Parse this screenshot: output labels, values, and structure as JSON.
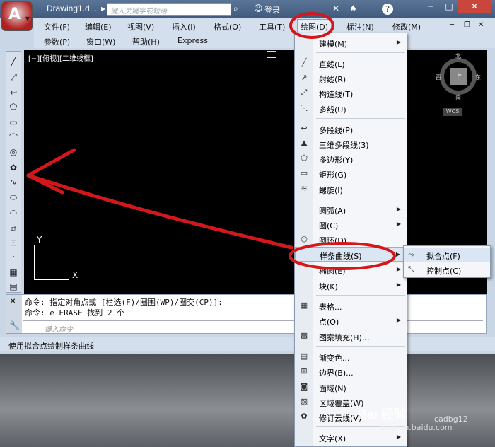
{
  "titlebar": {
    "doc_title": "Drawing1.d...",
    "search_placeholder": "键入关键字或短语",
    "login_label": "登录",
    "help_label": "?"
  },
  "menus": {
    "row1": [
      "文件(F)",
      "编辑(E)",
      "视图(V)",
      "插入(I)",
      "格式(O)",
      "工具(T)",
      "绘图(D)",
      "标注(N)",
      "修改(M)"
    ],
    "row2": [
      "参数(P)",
      "窗口(W)",
      "帮助(H)",
      "Express"
    ]
  },
  "canvas": {
    "view_label": "[−][俯视][二维线框]",
    "ucs_y": "Y",
    "ucs_x": "X"
  },
  "viewcube": {
    "north": "北",
    "south": "南",
    "east": "东",
    "west": "西",
    "top": "上",
    "wcs": "WCS"
  },
  "command": {
    "line1": "命令: 指定对角点或 [栏选(F)/圈围(WP)/圈交(CP)]:",
    "line2": "命令: e ERASE 找到 2 个",
    "input_placeholder": "键入命令"
  },
  "status": {
    "text": "使用拟合点绘制样条曲线"
  },
  "draw_menu": {
    "items": [
      {
        "label": "建模(M)",
        "icon": "",
        "submenu": true
      },
      {
        "label": "直线(L)",
        "icon": "line-icon",
        "submenu": false
      },
      {
        "label": "射线(R)",
        "icon": "ray-icon",
        "submenu": false
      },
      {
        "label": "构造线(T)",
        "icon": "xline-icon",
        "submenu": false
      },
      {
        "label": "多线(U)",
        "icon": "mline-icon",
        "submenu": false
      },
      {
        "label": "多段线(P)",
        "icon": "pline-icon",
        "submenu": false
      },
      {
        "label": "三维多段线(3)",
        "icon": "3dpoly-icon",
        "submenu": false
      },
      {
        "label": "多边形(Y)",
        "icon": "polygon-icon",
        "submenu": false
      },
      {
        "label": "矩形(G)",
        "icon": "rectangle-icon",
        "submenu": false
      },
      {
        "label": "螺旋(I)",
        "icon": "helix-icon",
        "submenu": false
      },
      {
        "label": "圆弧(A)",
        "icon": "",
        "submenu": true
      },
      {
        "label": "圆(C)",
        "icon": "",
        "submenu": true
      },
      {
        "label": "圆环(D)",
        "icon": "donut-icon",
        "submenu": false
      },
      {
        "label": "样条曲线(S)",
        "icon": "",
        "submenu": true
      },
      {
        "label": "椭圆(E)",
        "icon": "",
        "submenu": true
      },
      {
        "label": "块(K)",
        "icon": "",
        "submenu": true
      },
      {
        "label": "表格...",
        "icon": "table-icon",
        "submenu": false
      },
      {
        "label": "点(O)",
        "icon": "",
        "submenu": true
      },
      {
        "label": "图案填充(H)...",
        "icon": "hatch-icon",
        "submenu": false
      },
      {
        "label": "渐变色...",
        "icon": "gradient-icon",
        "submenu": false
      },
      {
        "label": "边界(B)...",
        "icon": "boundary-icon",
        "submenu": false
      },
      {
        "label": "面域(N)",
        "icon": "region-icon",
        "submenu": false
      },
      {
        "label": "区域覆盖(W)",
        "icon": "wipeout-icon",
        "submenu": false
      },
      {
        "label": "修订云线(V)",
        "icon": "revcloud-icon",
        "submenu": false
      },
      {
        "label": "文字(X)",
        "icon": "",
        "submenu": true
      }
    ]
  },
  "spline_submenu": {
    "items": [
      {
        "label": "拟合点(F)",
        "icon": "spline-fit-icon"
      },
      {
        "label": "控制点(C)",
        "icon": "spline-cv-icon"
      }
    ]
  },
  "watermark": {
    "brand": "Bai 经验",
    "url": "jingyan.baidu.com",
    "handle": "cadbg12"
  }
}
